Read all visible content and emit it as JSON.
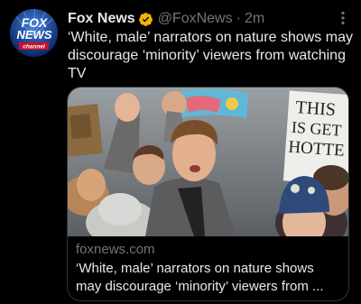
{
  "tweet": {
    "author_name": "Fox News",
    "handle": "@FoxNews",
    "separator": "·",
    "timestamp": "2m",
    "text": "‘White, male’ narrators on nature shows may discourage ‘minority’ viewers from watching TV",
    "verified": true
  },
  "avatar": {
    "logo_top": "FOX",
    "logo_middle": "NEWS",
    "logo_bottom": "channel"
  },
  "card": {
    "domain": "foxnews.com",
    "title_line1": "‘White, male’ narrators on nature shows",
    "title_line2": "may discourage ‘minority’ viewers from ...",
    "image_sign_text": [
      "THIS",
      "IS GET",
      "HOTTE"
    ]
  },
  "icons": {
    "verified": "verified-badge-icon",
    "more": "more-options-icon"
  },
  "colors": {
    "background": "#000000",
    "verified_badge": "#f4b400",
    "secondary_text": "#71767b",
    "card_border": "#2f3336"
  }
}
